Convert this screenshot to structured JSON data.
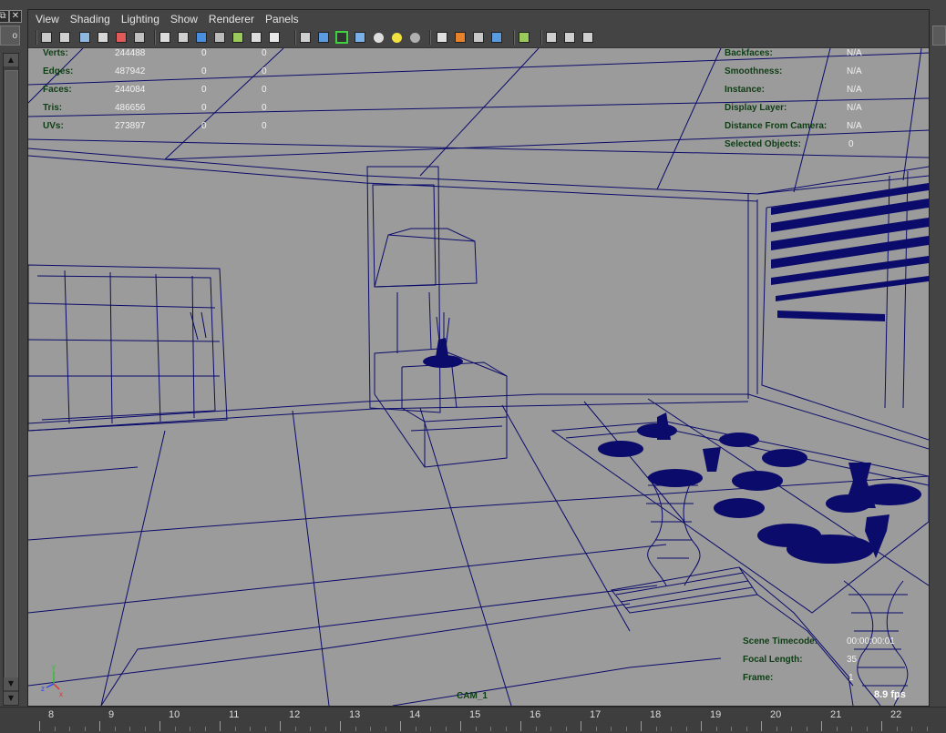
{
  "window_controls": [
    "⧉",
    "✕"
  ],
  "left_stub_label": "o",
  "menu": [
    "View",
    "Shading",
    "Lighting",
    "Show",
    "Renderer",
    "Panels"
  ],
  "toolbar_icons": [
    "select-camera-icon",
    "camera-attributes-icon",
    "bookmark-icon",
    "image-plane-icon",
    "grease-pencil-icon",
    "2d-pan-zoom-icon",
    "grid-icon",
    "film-gate-icon",
    "resolution-gate-icon",
    "gate-mask-icon",
    "field-chart-icon",
    "safe-action-icon",
    "safe-title-icon",
    "wireframe-icon",
    "smooth-shade-icon",
    "wireframe-on-shaded-icon",
    "default-material-icon",
    "textured-icon",
    "lights-icon",
    "shadows-icon",
    "screen-space-ao-icon",
    "motion-blur-icon",
    "multisample-aa-icon",
    "depth-of-field-icon",
    "isolate-select-icon",
    "xray-icon",
    "xray-active-components-icon",
    "xray-joints-icon"
  ],
  "hud_left": [
    {
      "label": "Verts:",
      "values": [
        "244488",
        "0",
        "0"
      ]
    },
    {
      "label": "Edges:",
      "values": [
        "487942",
        "0",
        "0"
      ]
    },
    {
      "label": "Faces:",
      "values": [
        "244084",
        "0",
        "0"
      ]
    },
    {
      "label": "Tris:",
      "values": [
        "486656",
        "0",
        "0"
      ]
    },
    {
      "label": "UVs:",
      "values": [
        "273897",
        "0",
        "0"
      ]
    }
  ],
  "hud_right": [
    {
      "label": "Backfaces:",
      "value": "N/A"
    },
    {
      "label": "Smoothness:",
      "value": "N/A"
    },
    {
      "label": "Instance:",
      "value": "N/A"
    },
    {
      "label": "Display Layer:",
      "value": "N/A"
    },
    {
      "label": "Distance From Camera:",
      "value": "N/A"
    },
    {
      "label": "Selected Objects:",
      "value": "0"
    }
  ],
  "hud_bottom": [
    {
      "label": "Scene Timecode:",
      "value": "00:00:00:01"
    },
    {
      "label": "Focal Length:",
      "value": "35"
    },
    {
      "label": "Frame:",
      "value": "1"
    }
  ],
  "fps": "8.9 fps",
  "camera_name": "CAM_1",
  "axis_labels": {
    "x": "x",
    "y": "y",
    "z": "z"
  },
  "colors": {
    "wire": "#0b0b6b",
    "viewport_bg": "#9b9b9b",
    "hud_label": "#0e3e14",
    "ui_bg": "#444444"
  },
  "timeline": {
    "labels": [
      "8",
      "9",
      "10",
      "11",
      "12",
      "13",
      "14",
      "15",
      "16",
      "17",
      "18",
      "19",
      "20",
      "21",
      "22"
    ]
  }
}
